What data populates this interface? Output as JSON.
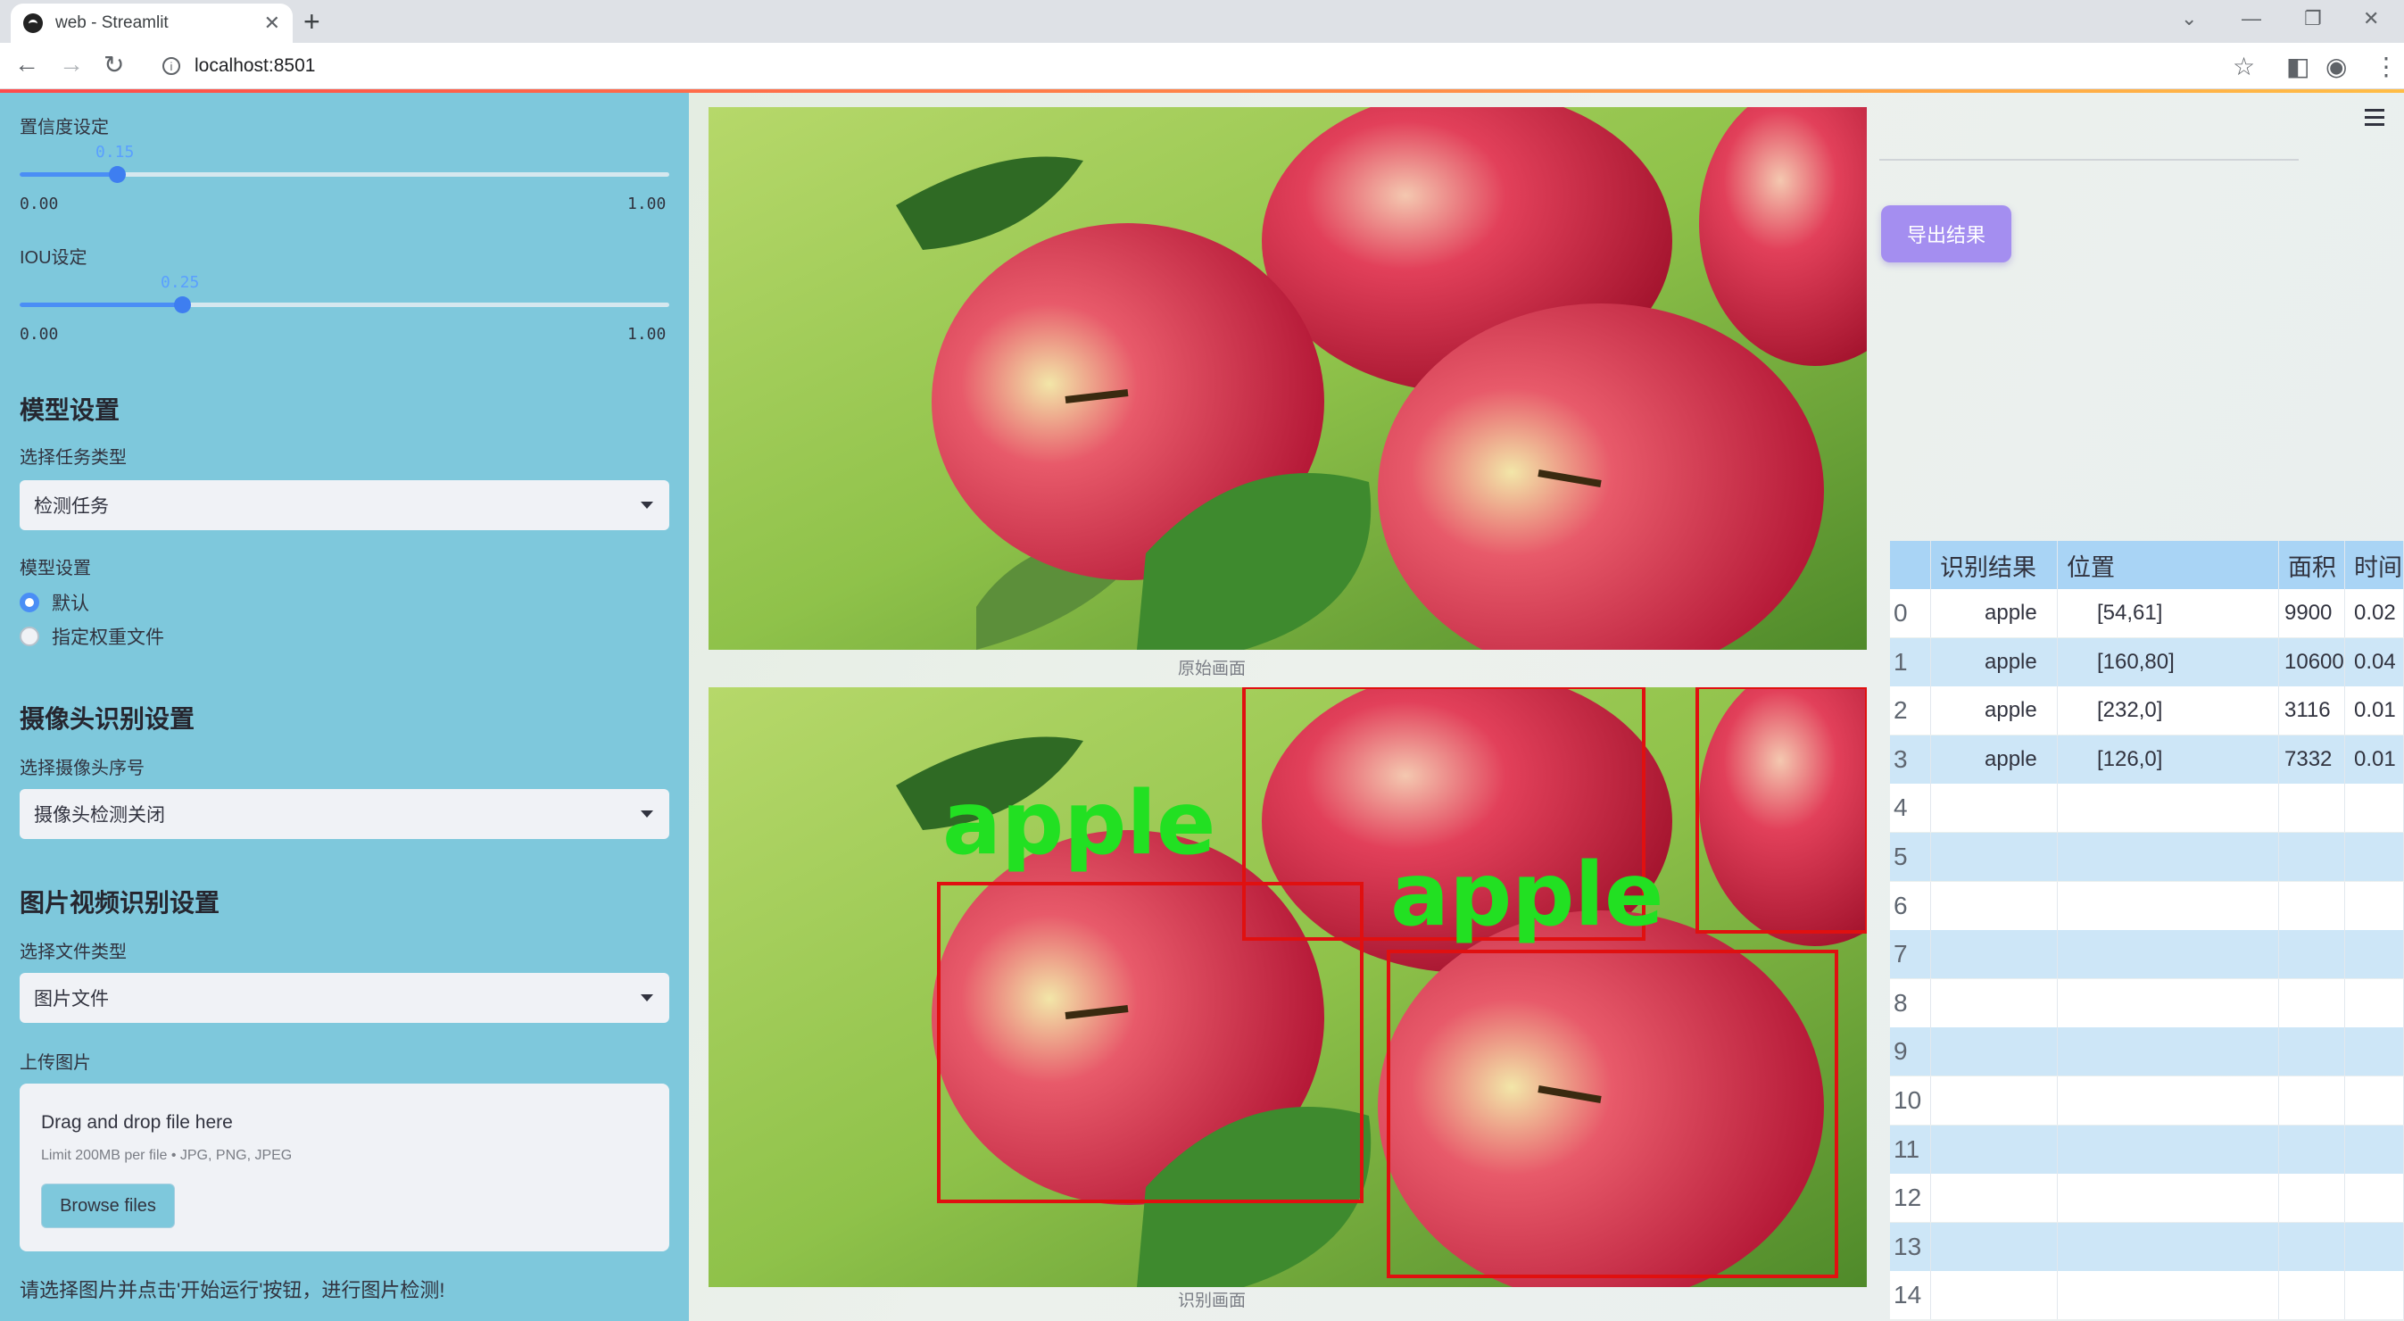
{
  "browser": {
    "tab_title": "web - Streamlit",
    "url": "localhost:8501"
  },
  "sidebar": {
    "conf_label": "置信度设定",
    "conf_value": "0.15",
    "conf_min": "0.00",
    "conf_max": "1.00",
    "conf_fraction": 0.15,
    "iou_label": "IOU设定",
    "iou_value": "0.25",
    "iou_min": "0.00",
    "iou_max": "1.00",
    "iou_fraction": 0.25,
    "model_section": "模型设置",
    "task_label": "选择任务类型",
    "task_value": "检测任务",
    "model_label": "模型设置",
    "model_options": [
      "默认",
      "指定权重文件"
    ],
    "model_selected": "默认",
    "camera_section": "摄像头识别设置",
    "camera_label": "选择摄像头序号",
    "camera_value": "摄像头检测关闭",
    "media_section": "图片视频识别设置",
    "filetype_label": "选择文件类型",
    "filetype_value": "图片文件",
    "upload_label": "上传图片",
    "drag_text": "Drag and drop file here",
    "limit_text": "Limit 200MB per file • JPG, PNG, JPEG",
    "browse_label": "Browse files",
    "hint": "请选择图片并点击'开始运行'按钮，进行图片检测!"
  },
  "main": {
    "original_caption": "原始画面",
    "result_caption": "识别画面",
    "box_label": "apple",
    "export_label": "导出结果"
  },
  "table": {
    "headers": [
      "",
      "识别结果",
      "位置",
      "面积",
      "时间"
    ],
    "rows": [
      {
        "idx": "0",
        "result": "apple",
        "pos": "[54,61]",
        "area": "9900",
        "time": "0.02"
      },
      {
        "idx": "1",
        "result": "apple",
        "pos": "[160,80]",
        "area": "10600",
        "time": "0.04"
      },
      {
        "idx": "2",
        "result": "apple",
        "pos": "[232,0]",
        "area": "3116",
        "time": "0.01"
      },
      {
        "idx": "3",
        "result": "apple",
        "pos": "[126,0]",
        "area": "7332",
        "time": "0.01"
      },
      {
        "idx": "4",
        "result": "",
        "pos": "",
        "area": "",
        "time": ""
      },
      {
        "idx": "5",
        "result": "",
        "pos": "",
        "area": "",
        "time": ""
      },
      {
        "idx": "6",
        "result": "",
        "pos": "",
        "area": "",
        "time": ""
      },
      {
        "idx": "7",
        "result": "",
        "pos": "",
        "area": "",
        "time": ""
      },
      {
        "idx": "8",
        "result": "",
        "pos": "",
        "area": "",
        "time": ""
      },
      {
        "idx": "9",
        "result": "",
        "pos": "",
        "area": "",
        "time": ""
      },
      {
        "idx": "10",
        "result": "",
        "pos": "",
        "area": "",
        "time": ""
      },
      {
        "idx": "11",
        "result": "",
        "pos": "",
        "area": "",
        "time": ""
      },
      {
        "idx": "12",
        "result": "",
        "pos": "",
        "area": "",
        "time": ""
      },
      {
        "idx": "13",
        "result": "",
        "pos": "",
        "area": "",
        "time": ""
      },
      {
        "idx": "14",
        "result": "",
        "pos": "",
        "area": "",
        "time": ""
      }
    ]
  },
  "colors": {
    "sidebar_bg": "#7ec8dc",
    "accent": "#4a8ef5",
    "export_button": "#a48ef0",
    "box_red": "#e01010",
    "label_green": "#22e022",
    "table_header": "#a9d4f5",
    "table_stripe": "#cde6f7"
  }
}
